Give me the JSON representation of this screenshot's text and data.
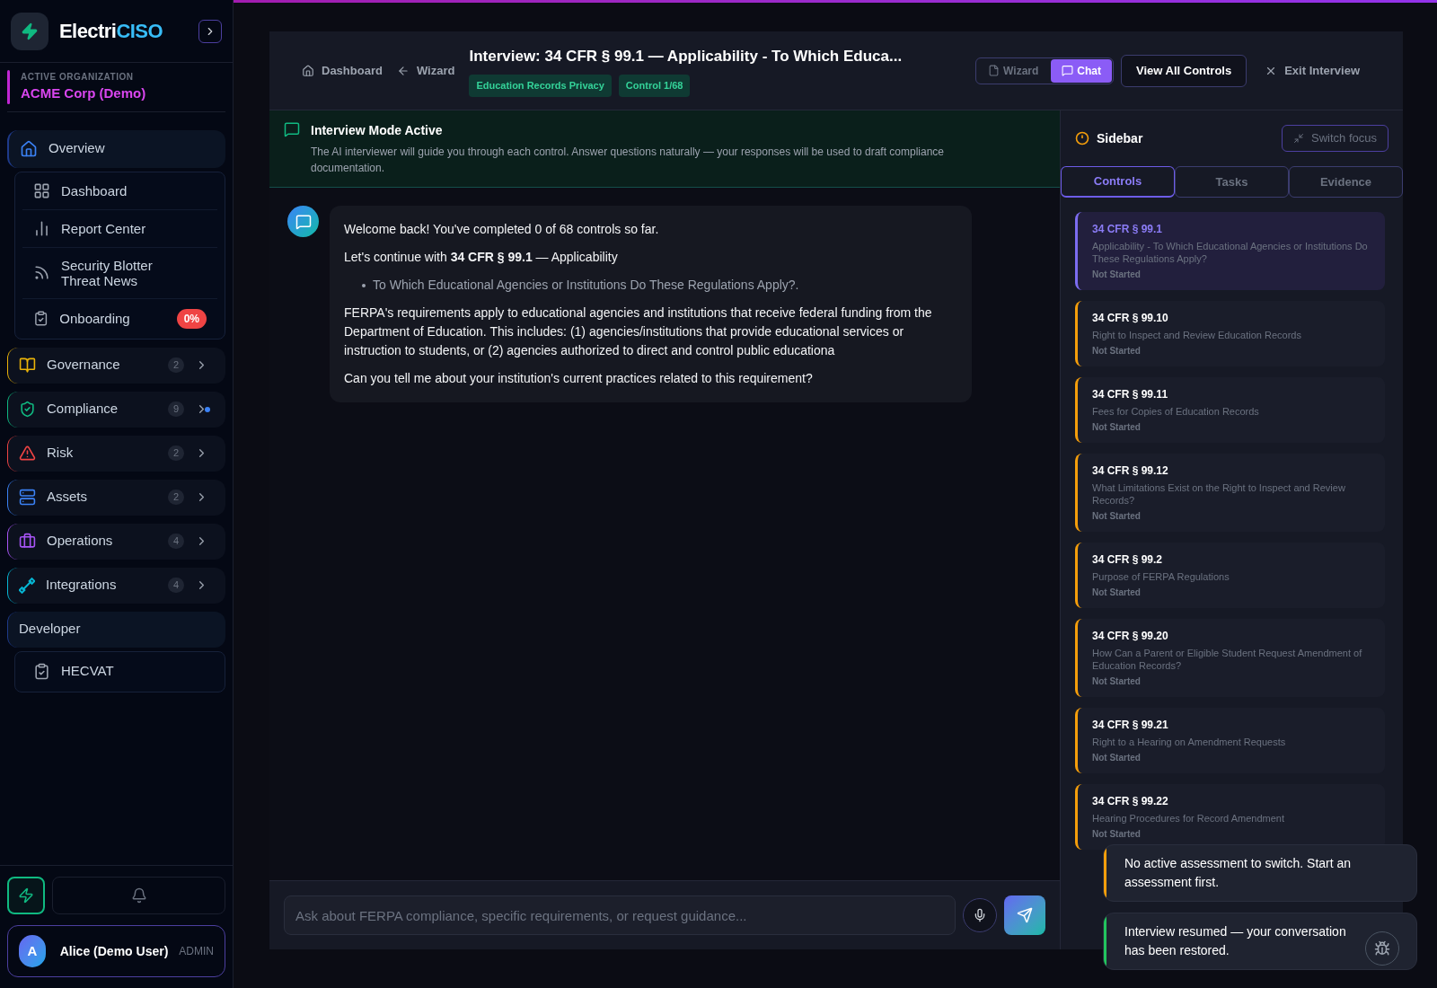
{
  "brand": {
    "name_start": "Electri",
    "name_end": "CISO"
  },
  "organization": {
    "label": "ACTIVE ORGANIZATION",
    "name": "ACME Corp (Demo)"
  },
  "nav": {
    "overview": {
      "label": "Overview",
      "expanded": true,
      "children": [
        {
          "label": "Dashboard"
        },
        {
          "label": "Report Center"
        },
        {
          "label": "Security Blotter Threat News"
        },
        {
          "label": "Onboarding",
          "badge": "0%"
        }
      ]
    },
    "sections": [
      {
        "label": "Governance",
        "count": "2",
        "color": "#eab308",
        "indicator": false
      },
      {
        "label": "Compliance",
        "count": "9",
        "color": "#10b981",
        "indicator": true
      },
      {
        "label": "Risk",
        "count": "2",
        "color": "#ef4444",
        "indicator": false
      },
      {
        "label": "Assets",
        "count": "2",
        "color": "#3b82f6",
        "indicator": false
      },
      {
        "label": "Operations",
        "count": "4",
        "color": "#a855f7",
        "indicator": false
      },
      {
        "label": "Integrations",
        "count": "4",
        "color": "#06b6d4",
        "indicator": false
      }
    ],
    "developer": {
      "label": "Developer",
      "expanded": true,
      "children": [
        {
          "label": "HECVAT"
        }
      ]
    }
  },
  "user": {
    "initial": "A",
    "name": "Alice (Demo User)",
    "role": "ADMIN"
  },
  "header": {
    "back_links": [
      "Dashboard",
      "Wizard"
    ],
    "title": "Interview: 34 CFR § 99.1 — Applicability - To Which Educa...",
    "tags": [
      "Education Records Privacy",
      "Control 1/68"
    ],
    "modes": [
      {
        "label": "Wizard",
        "selected": false
      },
      {
        "label": "Chat",
        "selected": true
      }
    ],
    "view_all": "View All Controls",
    "exit": "Exit Interview"
  },
  "banner": {
    "title": "Interview Mode Active",
    "text": "The AI interviewer will guide you through each control. Answer questions naturally — your responses will be used to draft compliance documentation."
  },
  "message": {
    "intro": "Welcome back! You've completed 0 of 68 controls so far.",
    "continue": "Let's continue with **34 CFR § 99.1** — Applicability",
    "bullets": [
      "To Which Educational Agencies or Institutions Do These Regulations Apply?."
    ],
    "body": "FERPA's requirements apply to educational agencies and institutions that receive federal funding from the Department of Education. This includes: (1) agencies/institutions that provide educational services or instruction to students, or (2) agencies authorized to direct and control public educationa",
    "question": "Can you tell me about your institution's current practices related to this requirement?"
  },
  "composer": {
    "placeholder": "Ask about FERPA compliance, specific requirements, or request guidance..."
  },
  "side_panel": {
    "title": "Sidebar",
    "switch_focus": "Switch focus",
    "tabs": [
      {
        "label": "Controls",
        "selected": true
      },
      {
        "label": "Tasks",
        "selected": false
      },
      {
        "label": "Evidence",
        "selected": false
      }
    ],
    "controls": [
      {
        "code": "34 CFR § 99.1",
        "title": "Applicability - To Which Educational Agencies or Institutions Do These Regulations Apply?",
        "status": "Not Started",
        "selected": true
      },
      {
        "code": "34 CFR § 99.10",
        "title": "Right to Inspect and Review Education Records",
        "status": "Not Started",
        "selected": false
      },
      {
        "code": "34 CFR § 99.11",
        "title": "Fees for Copies of Education Records",
        "status": "Not Started",
        "selected": false
      },
      {
        "code": "34 CFR § 99.12",
        "title": "What Limitations Exist on the Right to Inspect and Review Records?",
        "status": "Not Started",
        "selected": false
      },
      {
        "code": "34 CFR § 99.2",
        "title": "Purpose of FERPA Regulations",
        "status": "Not Started",
        "selected": false
      },
      {
        "code": "34 CFR § 99.20",
        "title": "How Can a Parent or Eligible Student Request Amendment of Education Records?",
        "status": "Not Started",
        "selected": false
      },
      {
        "code": "34 CFR § 99.21",
        "title": "Right to a Hearing on Amendment Requests",
        "status": "Not Started",
        "selected": false
      },
      {
        "code": "34 CFR § 99.22",
        "title": "Hearing Procedures for Record Amendment",
        "status": "Not Started",
        "selected": false
      }
    ]
  },
  "toasts": [
    {
      "text": "No active assessment to switch. Start an assessment first.",
      "color": "#f59e0b"
    },
    {
      "text": "Interview resumed — your conversation has been restored.",
      "color": "#22c55e"
    }
  ]
}
